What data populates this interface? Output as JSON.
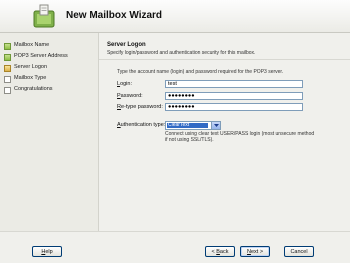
{
  "window": {
    "title": "New Mailbox Wizard"
  },
  "nav": {
    "items": [
      {
        "label": "Mailbox Name",
        "state": "done"
      },
      {
        "label": "POP3 Server Address",
        "state": "done"
      },
      {
        "label": "Server Logon",
        "state": "current"
      },
      {
        "label": "Mailbox Type",
        "state": "pending"
      },
      {
        "label": "Congratulations",
        "state": "pending"
      }
    ]
  },
  "page": {
    "title": "Server Logon",
    "subtitle": "Specify login/password and authentication security for this mailbox.",
    "instructions": "Type the account name (login) and password required for the POP3 server.",
    "login": {
      "label": "Login:",
      "value": "test"
    },
    "password": {
      "label": "Password:",
      "value": "●●●●●●●●"
    },
    "retype": {
      "label": "Re-type password:",
      "value": "●●●●●●●●"
    },
    "auth": {
      "label": "Authentication type:",
      "selected": "ClearText",
      "description": "Connect using clear text USER/PASS login (most unsecure method if not using SSL/TLS)."
    }
  },
  "footer": {
    "help": "Help",
    "back": "< Back",
    "next": "Next >",
    "cancel": "Cancel"
  },
  "colors": {
    "accent": "#316ac5",
    "done": "#8fbf45",
    "current": "#dcb14a",
    "border": "#7f9db9"
  },
  "icons": {
    "app": "mailbox-wizard-icon",
    "dropdown": "dropdown-arrow-icon"
  }
}
